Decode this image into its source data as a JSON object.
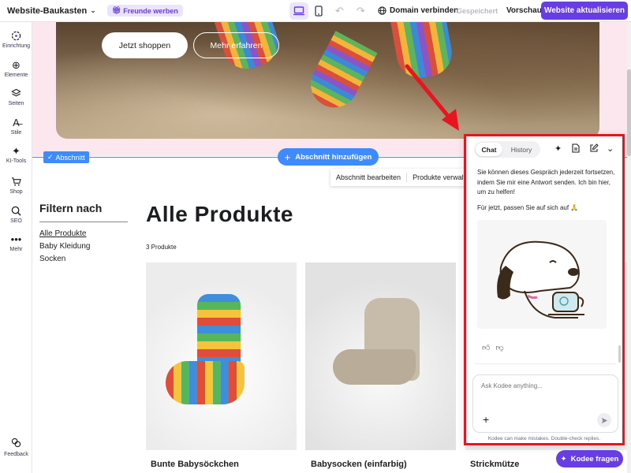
{
  "topbar": {
    "app_title": "Website-Baukasten",
    "refer_label": "Freunde werben",
    "domain_label": "Domain verbinden",
    "saved_label": "Gespeichert",
    "preview_label": "Vorschau",
    "update_label": "Website aktualisieren"
  },
  "sidebar": {
    "items": [
      {
        "label": "Einrichtung",
        "icon": "setup-icon"
      },
      {
        "label": "Elemente",
        "icon": "plus-circle-icon"
      },
      {
        "label": "Seiten",
        "icon": "layers-icon"
      },
      {
        "label": "Stile",
        "icon": "styles-icon"
      },
      {
        "label": "KI-Tools",
        "icon": "sparkle-icon"
      },
      {
        "label": "Shop",
        "icon": "cart-icon"
      },
      {
        "label": "SEO",
        "icon": "seo-icon"
      },
      {
        "label": "Mehr",
        "icon": "more-icon"
      }
    ],
    "feedback_label": "Feedback"
  },
  "hero": {
    "shop_button": "Jetzt shoppen",
    "more_button": "Mehr erfahren"
  },
  "editor": {
    "section_tag": "Abschnitt",
    "add_section": "Abschnitt hinzufügen",
    "edit_section": "Abschnitt bearbeiten",
    "manage_products": "Produkte verwalten"
  },
  "filters": {
    "title": "Filtern nach",
    "items": [
      "Alle Produkte",
      "Baby Kleidung",
      "Socken"
    ]
  },
  "products": {
    "heading": "Alle Produkte",
    "count": "3 Produkte",
    "items": [
      {
        "name": "Bunte Babysöckchen"
      },
      {
        "name": "Babysocken (einfarbig)"
      },
      {
        "name": "Strickmütze"
      }
    ]
  },
  "chat": {
    "tab_chat": "Chat",
    "tab_history": "History",
    "message": "Sie können dieses Gespräch jederzeit fortsetzen, indem Sie mir eine Antwort senden. Ich bin hier, um zu helfen!",
    "message2": "Für jetzt, passen Sie auf sich auf 🙏",
    "input_placeholder": "Ask Kodee anything...",
    "disclaimer": "Kodee can make mistakes. Double-check replies.",
    "open_button": "Kodee fragen"
  },
  "colors": {
    "brand": "#673de6",
    "editor_blue": "#3e8bff",
    "highlight_red": "#e8141e",
    "hero_pink": "#fde7ef"
  }
}
